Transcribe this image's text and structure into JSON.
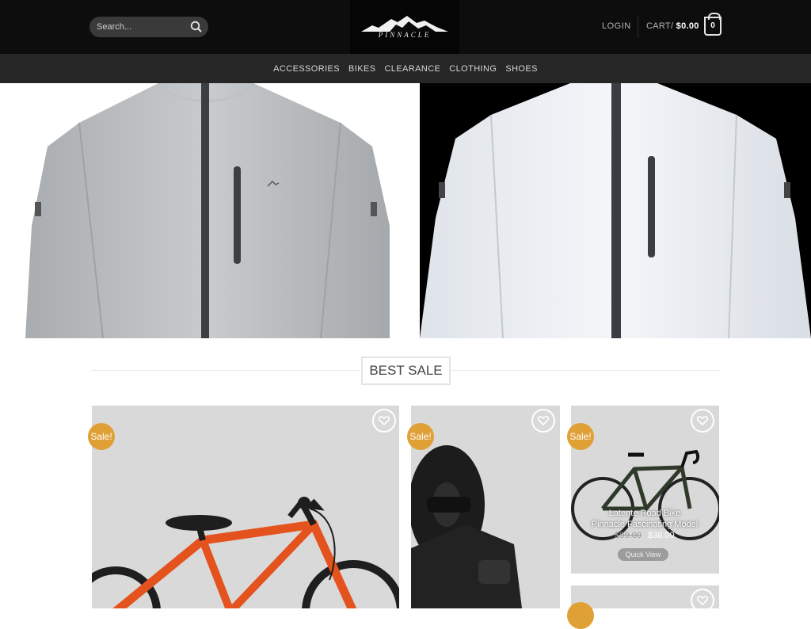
{
  "header": {
    "search": {
      "placeholder": "Search..."
    },
    "logo": {
      "text": "PINNACLE"
    },
    "login_label": "LOGIN",
    "cart": {
      "label": "CART",
      "separator": "/",
      "total": "$0.00",
      "count": "0"
    }
  },
  "nav": {
    "items": [
      "ACCESSORIES",
      "BIKES",
      "CLEARANCE",
      "CLOTHING",
      "SHOES"
    ]
  },
  "hero": {
    "left_image": "jacket-grey",
    "right_image": "jacket-reflective"
  },
  "section": {
    "title": "BEST SALE"
  },
  "products": [
    {
      "badge": "Sale!",
      "image": "kids-bike-orange",
      "icon": "heart-icon"
    },
    {
      "badge": "Sale!",
      "image": "bike-trainer",
      "icon": "heart-icon"
    },
    {
      "badge": "Sale!",
      "image": "road-bike",
      "icon": "heart-icon",
      "title_line1": "Latente Road Bike",
      "title_line2": "Pinnacle Fascinating Model",
      "old_price": "$99.00",
      "price": "$38.00",
      "quick_view": "Quick View"
    }
  ],
  "colors": {
    "topbar": "#0d0d0d",
    "nav": "#262626",
    "badge": "#dfa035"
  }
}
